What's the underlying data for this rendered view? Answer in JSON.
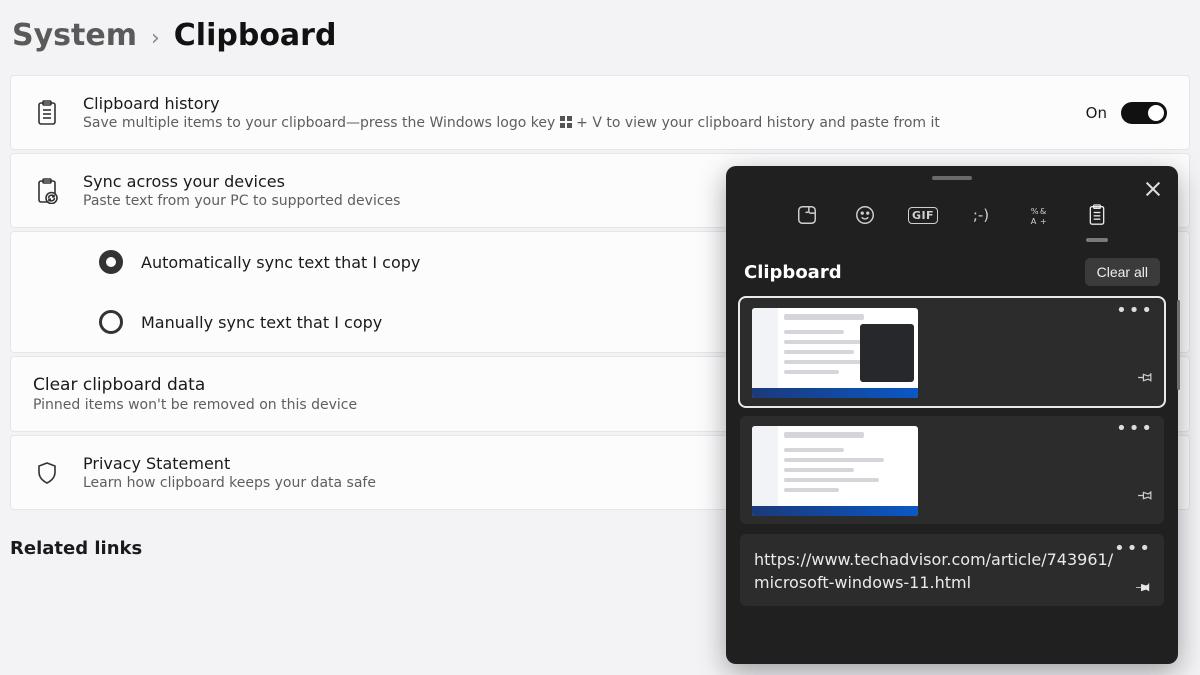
{
  "breadcrumb": {
    "parent": "System",
    "current": "Clipboard"
  },
  "cards": {
    "history": {
      "title": "Clipboard history",
      "desc_pre": "Save multiple items to your clipboard—press the Windows logo key ",
      "desc_post": " + V to view your clipboard history and paste from it",
      "toggle_state_label": "On",
      "toggle_on": true
    },
    "sync": {
      "title": "Sync across your devices",
      "desc": "Paste text from your PC to supported devices",
      "options": {
        "auto": "Automatically sync text that I copy",
        "manual": "Manually sync text that I copy",
        "selected": "auto"
      }
    },
    "clear": {
      "title": "Clear clipboard data",
      "desc": "Pinned items won't be removed on this device"
    },
    "privacy": {
      "title": "Privacy Statement",
      "desc": "Learn how clipboard keeps your data safe"
    }
  },
  "related_heading": "Related links",
  "popup": {
    "title": "Clipboard",
    "clear_all": "Clear all",
    "tabs": [
      "sticker",
      "emoji",
      "gif",
      "kaomoji",
      "symbols",
      "clipboard"
    ],
    "active_tab": "clipboard",
    "items": [
      {
        "type": "image",
        "pinned": false
      },
      {
        "type": "image",
        "pinned": false
      },
      {
        "type": "text",
        "pinned": true,
        "text": "https://www.techadvisor.com/article/743961/microsoft-windows-11.html"
      }
    ]
  }
}
